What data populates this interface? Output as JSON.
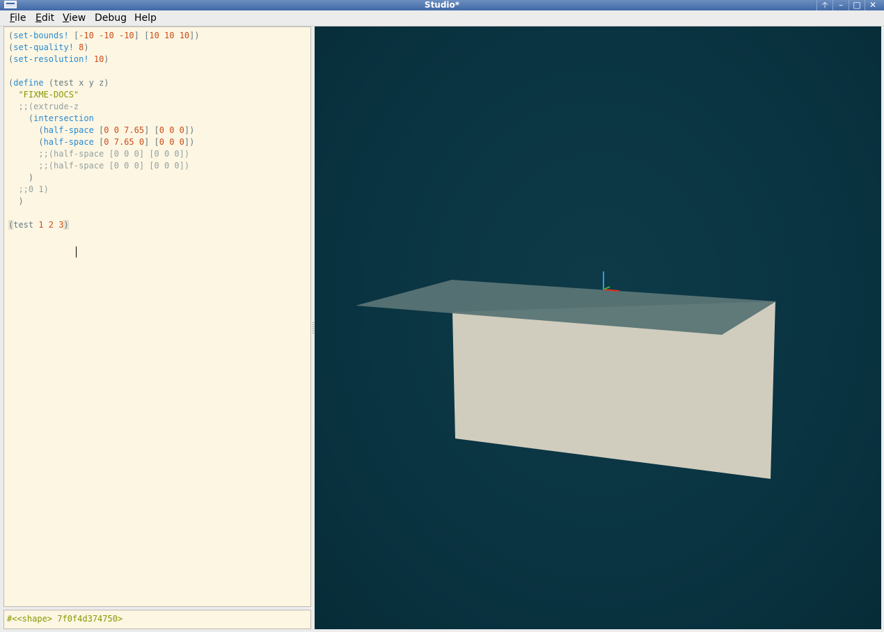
{
  "window": {
    "title": "Studio*",
    "buttons": [
      "🡡",
      "–",
      "□",
      "✕"
    ]
  },
  "menubar": {
    "items": [
      {
        "label": "File",
        "mnemonic": "F",
        "rest": "ile"
      },
      {
        "label": "Edit",
        "mnemonic": "E",
        "rest": "dit"
      },
      {
        "label": "View",
        "mnemonic": "V",
        "rest": "iew"
      },
      {
        "label": "Debug",
        "mnemonic": "",
        "rest": "Debug"
      },
      {
        "label": "Help",
        "mnemonic": "",
        "rest": "Help"
      }
    ]
  },
  "editor": {
    "lines": [
      [
        [
          "p",
          "("
        ],
        [
          "kw",
          "set-bounds!"
        ],
        [
          "p",
          " ["
        ],
        [
          "num",
          "-10 -10 -10"
        ],
        [
          "p",
          "] ["
        ],
        [
          "num",
          "10 10 10"
        ],
        [
          "p",
          "])"
        ]
      ],
      [
        [
          "p",
          "("
        ],
        [
          "kw",
          "set-quality!"
        ],
        [
          "p",
          " "
        ],
        [
          "num",
          "8"
        ],
        [
          "p",
          ")"
        ]
      ],
      [
        [
          "p",
          "("
        ],
        [
          "kw",
          "set-resolution!"
        ],
        [
          "p",
          " "
        ],
        [
          "num",
          "10"
        ],
        [
          "p",
          ")"
        ]
      ],
      [],
      [
        [
          "p",
          "("
        ],
        [
          "kw",
          "define"
        ],
        [
          "p",
          " (test x y z)"
        ]
      ],
      [
        [
          "p",
          "  "
        ],
        [
          "str",
          "\"FIXME-DOCS\""
        ]
      ],
      [
        [
          "p",
          "  "
        ],
        [
          "cmt",
          ";;(extrude-z"
        ]
      ],
      [
        [
          "p",
          "    ("
        ],
        [
          "kw",
          "intersection"
        ]
      ],
      [
        [
          "p",
          "      ("
        ],
        [
          "kw",
          "half-space"
        ],
        [
          "p",
          " ["
        ],
        [
          "num",
          "0 0 7.65"
        ],
        [
          "p",
          "] ["
        ],
        [
          "num",
          "0 0 0"
        ],
        [
          "p",
          "])"
        ]
      ],
      [
        [
          "p",
          "      ("
        ],
        [
          "kw",
          "half-space"
        ],
        [
          "p",
          " ["
        ],
        [
          "num",
          "0 7.65 0"
        ],
        [
          "p",
          "] ["
        ],
        [
          "num",
          "0 0 0"
        ],
        [
          "p",
          "])"
        ]
      ],
      [
        [
          "p",
          "      "
        ],
        [
          "cmt",
          ";;(half-space [0 0 0] [0 0 0])"
        ]
      ],
      [
        [
          "p",
          "      "
        ],
        [
          "cmt",
          ";;(half-space [0 0 0] [0 0 0])"
        ]
      ],
      [
        [
          "p",
          "    )"
        ]
      ],
      [
        [
          "p",
          "  "
        ],
        [
          "cmt",
          ";;0 1)"
        ]
      ],
      [
        [
          "p",
          "  )"
        ]
      ],
      [],
      [
        [
          "hl",
          "("
        ],
        [
          "p",
          "test "
        ],
        [
          "num",
          "1 2 3"
        ],
        [
          "hl",
          ")"
        ]
      ]
    ]
  },
  "output": {
    "text": "#<<shape> 7f0f4d374750>"
  },
  "viewport": {
    "background": "#0a3442",
    "top_face_color": "#5a7475",
    "front_face_color": "#d0cdbe",
    "axis_colors": {
      "x": "#e03020",
      "y": "#40b040",
      "z": "#2aa0e0"
    }
  }
}
